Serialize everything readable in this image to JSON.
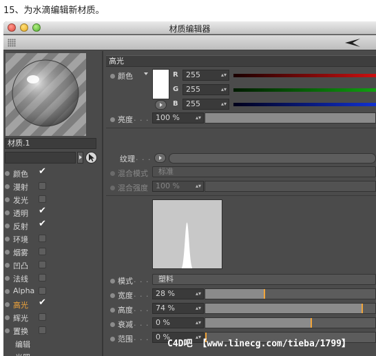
{
  "caption": "15、为水滴编辑新材质。",
  "window": {
    "title": "材质编辑器"
  },
  "preview": {
    "material_name": "材质.1"
  },
  "channels": [
    {
      "label": "颜色",
      "checked": true,
      "active": false
    },
    {
      "label": "漫射",
      "checked": false,
      "active": false
    },
    {
      "label": "发光",
      "checked": false,
      "active": false
    },
    {
      "label": "透明",
      "checked": true,
      "active": false
    },
    {
      "label": "反射",
      "checked": true,
      "active": false
    },
    {
      "label": "环境",
      "checked": false,
      "active": false
    },
    {
      "label": "烟雾",
      "checked": false,
      "active": false
    },
    {
      "label": "凹凸",
      "checked": false,
      "active": false
    },
    {
      "label": "法线",
      "checked": false,
      "active": false
    },
    {
      "label": "Alpha",
      "checked": false,
      "active": false
    },
    {
      "label": "高光",
      "checked": true,
      "active": true
    },
    {
      "label": "辉光",
      "checked": false,
      "active": false
    },
    {
      "label": "置换",
      "checked": false,
      "active": false
    },
    {
      "label": "编辑",
      "checked": null,
      "active": false
    },
    {
      "label": "光照",
      "checked": null,
      "active": false
    }
  ],
  "section": {
    "title": "高光"
  },
  "color": {
    "label": "颜色",
    "swatch": "#ffffff",
    "r_label": "R",
    "r_value": "255",
    "g_label": "G",
    "g_value": "255",
    "b_label": "B",
    "b_value": "255"
  },
  "brightness": {
    "label": "亮度",
    "dots": ". . .",
    "value": "100 %",
    "percent": 100
  },
  "texture": {
    "label": "纹理",
    "dots": ". . . ."
  },
  "blend_mode": {
    "label": "混合模式",
    "value": "标准"
  },
  "blend_strength": {
    "label": "混合强度",
    "value": "100 %"
  },
  "mode": {
    "label": "模式",
    "dots": ". . . .",
    "value": "塑料"
  },
  "width": {
    "label": "宽度",
    "dots": ". . . .",
    "value": "28 %",
    "percent": 28
  },
  "height": {
    "label": "高度",
    "dots": ". . . .",
    "value": "74 %",
    "percent": 74
  },
  "falloff": {
    "label": "衰减",
    "dots": ". . . .",
    "value": "0 %",
    "percent": 0
  },
  "range": {
    "label": "范围",
    "dots": ". . . .",
    "value": "0 %",
    "percent": 0
  },
  "colors": {
    "accent": "#f2a53a",
    "panel": "#4b4b4b",
    "red": "#cc1010",
    "green": "#10a010",
    "blue": "#1030d0"
  },
  "watermark": "C4D吧 【www.linecg.com/tieba/1799】"
}
